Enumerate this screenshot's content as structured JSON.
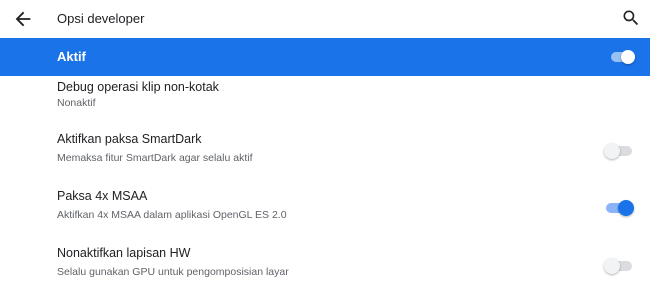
{
  "appbar": {
    "title": "Opsi developer",
    "back_icon": "arrow-back-icon",
    "search_icon": "search-icon"
  },
  "master_toggle": {
    "label": "Aktif",
    "state": "on",
    "color": "#1a73e8"
  },
  "settings": [
    {
      "title": "Debug operasi klip non-kotak",
      "summary": "Nonaktif"
    },
    {
      "title": "Aktifkan paksa SmartDark",
      "summary": "Memaksa fitur SmartDark agar selalu aktif",
      "toggle": "off"
    },
    {
      "title": "Paksa 4x MSAA",
      "summary": "Aktifkan 4x MSAA dalam aplikasi OpenGL ES 2.0",
      "toggle": "on"
    },
    {
      "title": "Nonaktifkan lapisan HW",
      "summary": "Selalu gunakan GPU untuk pengomposisian layar",
      "toggle": "off"
    }
  ]
}
